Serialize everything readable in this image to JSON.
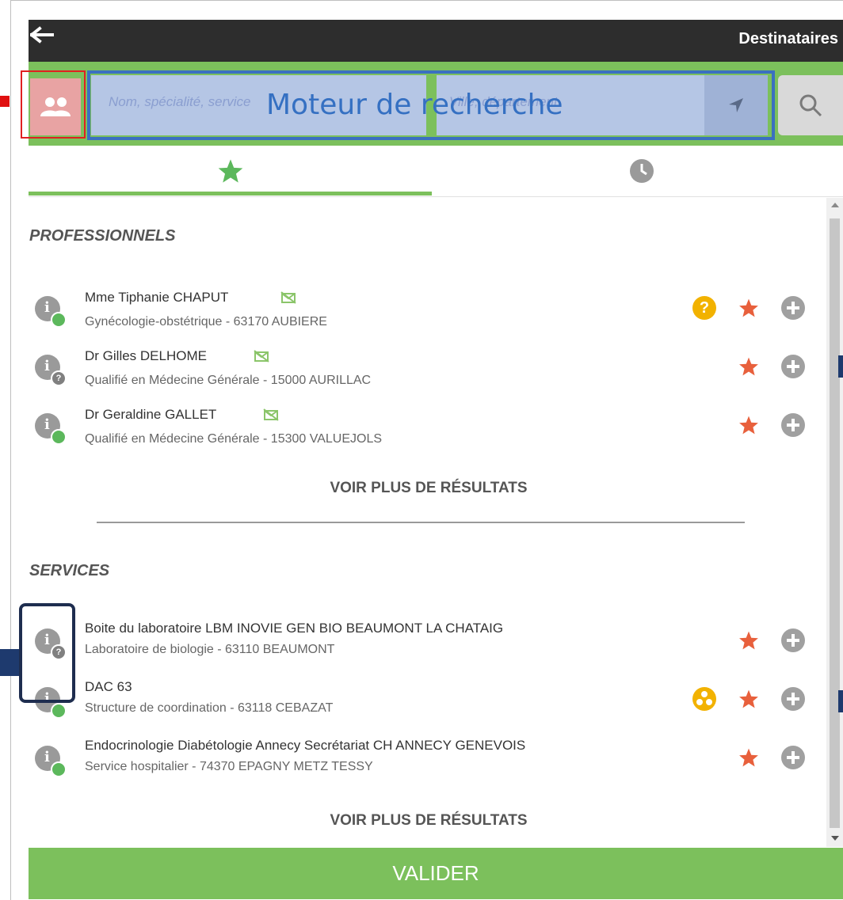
{
  "header": {
    "title": "Destinataires",
    "back_icon": "arrow-left-icon"
  },
  "search": {
    "name_placeholder": "Nom, spécialité, service",
    "city_placeholder": "Ville, département",
    "overlay_label": "Moteur de recherche"
  },
  "tabs": [
    {
      "icon": "star-icon",
      "active": true
    },
    {
      "icon": "clock-icon",
      "active": false
    }
  ],
  "professionals": {
    "title": "PROFESSIONNELS",
    "items": [
      {
        "name": "Mme Tiphanie CHAPUT",
        "detail": "Gynécologie-obstétrique - 63170 AUBIERE",
        "status": "ok",
        "help": true
      },
      {
        "name": "Dr Gilles DELHOME",
        "detail": "Qualifié en Médecine Générale - 15000 AURILLAC",
        "status": "unknown",
        "help": false
      },
      {
        "name": "Dr Geraldine GALLET",
        "detail": "Qualifié en Médecine Générale - 15300 VALUEJOLS",
        "status": "ok",
        "help": false
      }
    ],
    "more_label": "VOIR PLUS DE RÉSULTATS"
  },
  "services": {
    "title": "SERVICES",
    "items": [
      {
        "name": "Boite du laboratoire LBM INOVIE GEN BIO BEAUMONT LA CHATAIG",
        "detail": "Laboratoire de biologie - 63110 BEAUMONT",
        "status": "unknown"
      },
      {
        "name": "DAC 63",
        "detail": "Structure de coordination - 63118 CEBAZAT",
        "status": "ok"
      },
      {
        "name": "Endocrinologie Diabétologie Annecy Secrétariat CH ANNECY GENEVOIS",
        "detail": "Service hospitalier - 74370 EPAGNY METZ TESSY",
        "status": "ok"
      }
    ],
    "more_label": "VOIR PLUS DE RÉSULTATS"
  },
  "footer": {
    "validate_label": "VALIDER"
  },
  "colors": {
    "green": "#7cc05c",
    "star": "#e8603c",
    "gold": "#f2b200",
    "dark": "#2d2d2d"
  }
}
